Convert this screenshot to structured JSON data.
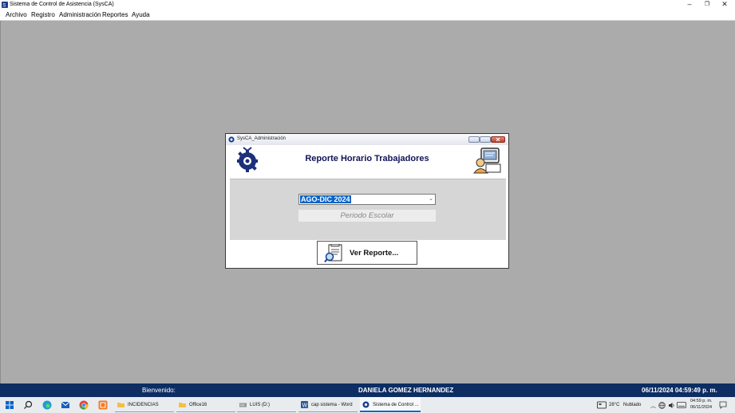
{
  "window": {
    "title": "Sistema de Control de Asistencia (SysCA)",
    "minimize": "–",
    "restore": "❐",
    "close": "✕"
  },
  "menu": [
    "Archivo",
    "Registro",
    "Administración",
    "Reportes",
    "Ayuda"
  ],
  "dialog": {
    "title": "SysCA_Administración",
    "heading": "Reporte Horario Trabajadores",
    "period_value": "AGO-DIC 2024",
    "period_label": "Periodo Escolar",
    "button_label": "Ver Reporte..."
  },
  "status": {
    "welcome": "Bienvenido:",
    "user": "DANIELA GOMEZ HERNANDEZ",
    "datetime": "06/11/2024 04:59:49 p. m."
  },
  "taskbar": {
    "tasks": [
      {
        "label": "INCIDENCIAS",
        "icon": "folder-icon"
      },
      {
        "label": "Office16",
        "icon": "folder-icon"
      },
      {
        "label": "LUIS (D:)",
        "icon": "drive-icon"
      },
      {
        "label": "cap sistema - Word",
        "icon": "word-icon"
      },
      {
        "label": "Sistema de Control ...",
        "icon": "sysca-icon"
      }
    ],
    "weather_temp": "28°C",
    "weather_text": "Nublado",
    "clock_time": "04:59 p. m.",
    "clock_date": "06/11/2024"
  },
  "colors": {
    "statusbar": "#0d2d63",
    "heading": "#12125a",
    "selection": "#0a64c8"
  }
}
